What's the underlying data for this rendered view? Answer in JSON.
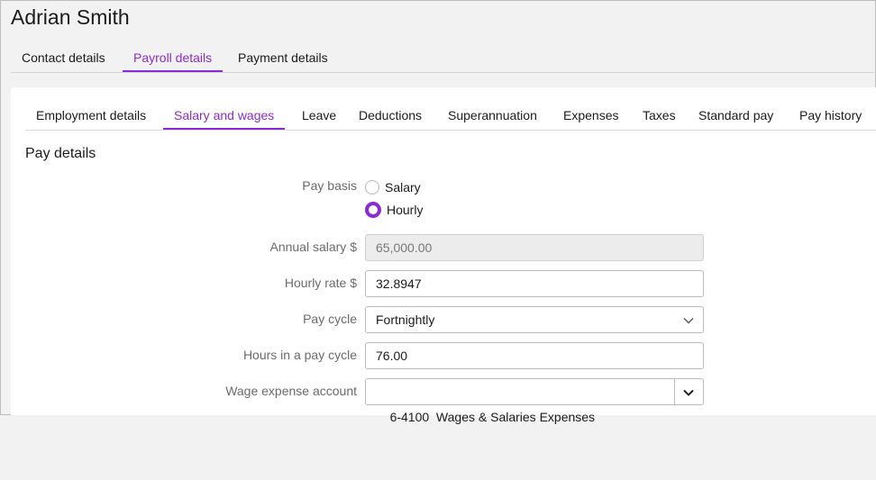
{
  "contact": {
    "name": "Adrian Smith"
  },
  "top_tabs": [
    {
      "label": "Contact details"
    },
    {
      "label": "Payroll details"
    },
    {
      "label": "Payment details"
    }
  ],
  "sub_tabs": [
    {
      "label": "Employment details"
    },
    {
      "label": "Salary and wages"
    },
    {
      "label": "Leave"
    },
    {
      "label": "Deductions"
    },
    {
      "label": "Superannuation"
    },
    {
      "label": "Expenses"
    },
    {
      "label": "Taxes"
    },
    {
      "label": "Standard pay"
    },
    {
      "label": "Pay history"
    }
  ],
  "active_top_tab": "Payroll details",
  "active_sub_tab": "Salary and wages",
  "section": {
    "title": "Pay details"
  },
  "form": {
    "pay_basis": {
      "label": "Pay basis",
      "options": [
        "Salary",
        "Hourly"
      ],
      "selected": "Hourly"
    },
    "annual_salary": {
      "label": "Annual salary $",
      "value": "65,000.00"
    },
    "hourly_rate": {
      "label": "Hourly rate $",
      "value": "32.8947"
    },
    "pay_cycle": {
      "label": "Pay cycle",
      "value": "Fortnightly"
    },
    "hours_in_cycle": {
      "label": "Hours in a pay cycle",
      "value": "76.00"
    },
    "wage_expense_account": {
      "label": "Wage expense account",
      "value": "6-4100  Wages & Salaries Expenses"
    }
  },
  "colors": {
    "accent": "#8b2bd6",
    "background": "#f2f2f2",
    "panel": "#ffffff"
  }
}
